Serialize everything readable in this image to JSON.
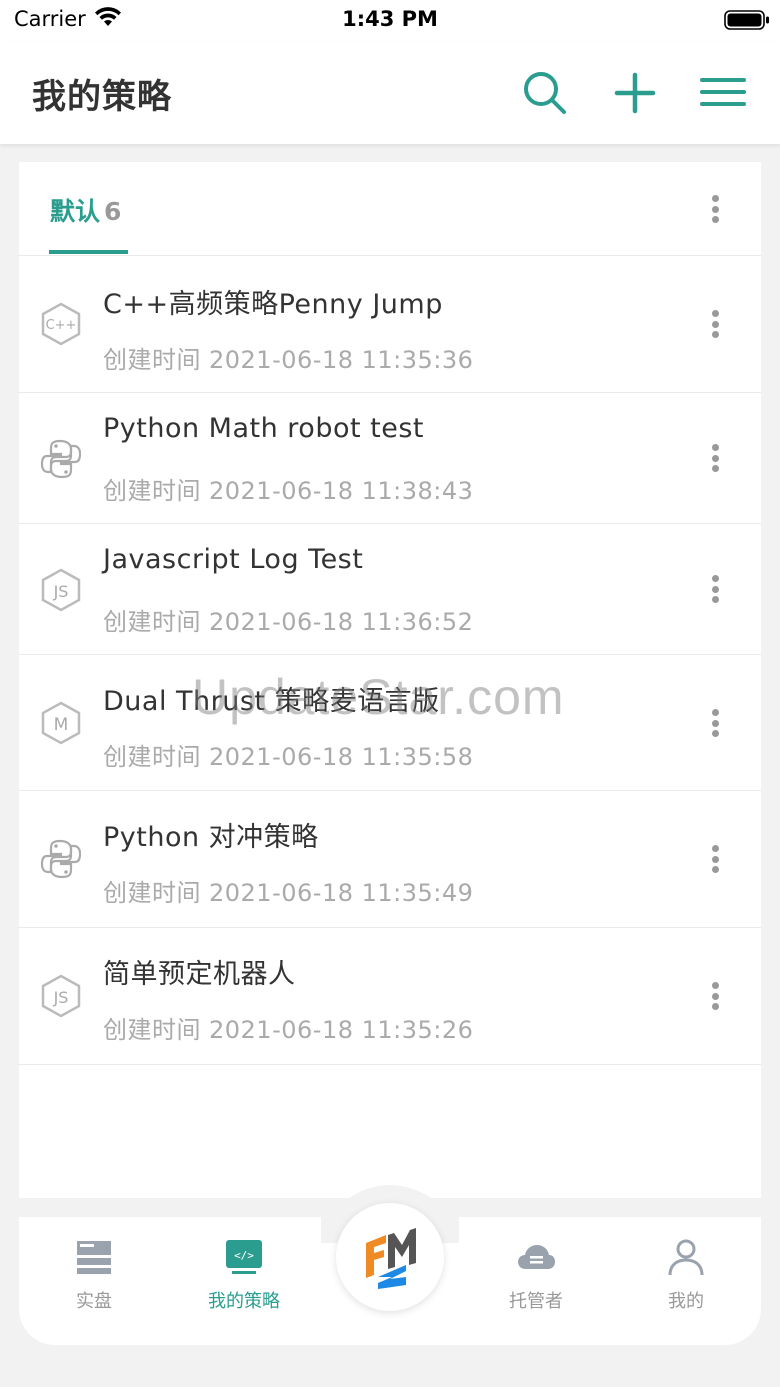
{
  "status_bar": {
    "carrier": "Carrier",
    "time": "1:43 PM"
  },
  "nav": {
    "title": "我的策略",
    "icons": [
      "search-icon",
      "plus-icon",
      "menu-icon"
    ],
    "accent_color": "#2a9d8f"
  },
  "group_tab": {
    "label": "默认",
    "count": "6"
  },
  "strategies": [
    {
      "icon": "cpp-icon",
      "title": "C++高频策略Penny Jump",
      "time_label": "创建时间",
      "time": "2021-06-18 11:35:36"
    },
    {
      "icon": "python-icon",
      "title": "Python Math robot test",
      "time_label": "创建时间",
      "time": "2021-06-18 11:38:43"
    },
    {
      "icon": "javascript-icon",
      "title": "Javascript Log Test",
      "time_label": "创建时间",
      "time": "2021-06-18 11:36:52"
    },
    {
      "icon": "mylanguage-icon",
      "title": "Dual Thrust 策略麦语言版",
      "time_label": "创建时间",
      "time": "2021-06-18 11:35:58"
    },
    {
      "icon": "python-icon",
      "title": "Python 对冲策略",
      "time_label": "创建时间",
      "time": "2021-06-18 11:35:49"
    },
    {
      "icon": "javascript-icon",
      "title": "简单预定机器人",
      "time_label": "创建时间",
      "time": "2021-06-18 11:35:26"
    }
  ],
  "watermark": "UpdateStar.com",
  "tab_bar": {
    "tabs": [
      {
        "label": "实盘",
        "icon": "server-icon",
        "active": false
      },
      {
        "label": "我的策略",
        "icon": "code-screen-icon",
        "active": true
      },
      {
        "label": "托管者",
        "icon": "cloud-icon",
        "active": false
      },
      {
        "label": "我的",
        "icon": "user-icon",
        "active": false
      }
    ],
    "center_logo": "fmz-logo"
  }
}
